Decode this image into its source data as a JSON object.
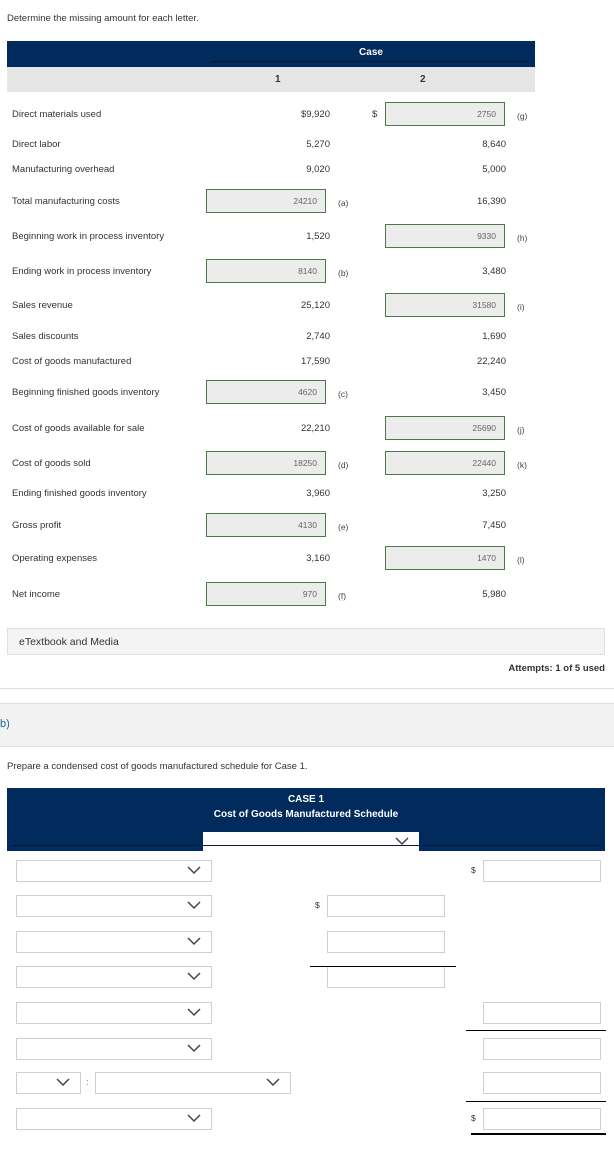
{
  "part_a": {
    "instruction": "Determine the missing amount for each letter.",
    "header": {
      "group_label": "Case",
      "columns": [
        "1",
        "2"
      ]
    },
    "rows": [
      {
        "label": "Direct materials used",
        "case1": "$9,920",
        "case2": {
          "input": "2750",
          "letter": "(g)",
          "prefix": "$"
        }
      },
      {
        "label": "Direct labor",
        "case1": "5,270",
        "case2": "8,640"
      },
      {
        "label": "Manufacturing overhead",
        "case1": "9,020",
        "case2": "5,000"
      },
      {
        "label": "Total manufacturing costs",
        "case1": {
          "input": "24210",
          "letter": "(a)"
        },
        "case2": "16,390"
      },
      {
        "label": "Beginning work in process inventory",
        "case1": "1,520",
        "case2": {
          "input": "9330",
          "letter": "(h)"
        }
      },
      {
        "label": "Ending work in process inventory",
        "case1": {
          "input": "8140",
          "letter": "(b)"
        },
        "case2": "3,480"
      },
      {
        "label": "Sales revenue",
        "case1": "25,120",
        "case2": {
          "input": "31580",
          "letter": "(i)"
        }
      },
      {
        "label": "Sales discounts",
        "case1": "2,740",
        "case2": "1,690"
      },
      {
        "label": "Cost of goods manufactured",
        "case1": "17,590",
        "case2": "22,240"
      },
      {
        "label": "Beginning finished goods inventory",
        "case1": {
          "input": "4620",
          "letter": "(c)"
        },
        "case2": "3,450"
      },
      {
        "label": "Cost of goods available for sale",
        "case1": "22,210",
        "case2": {
          "input": "25690",
          "letter": "(j)"
        }
      },
      {
        "label": "Cost of goods sold",
        "case1": {
          "input": "18250",
          "letter": "(d)"
        },
        "case2": {
          "input": "22440",
          "letter": "(k)"
        }
      },
      {
        "label": "Ending finished goods inventory",
        "case1": "3,960",
        "case2": "3,250"
      },
      {
        "label": "Gross profit",
        "case1": {
          "input": "4130",
          "letter": "(e)"
        },
        "case2": "7,450"
      },
      {
        "label": "Operating expenses",
        "case1": "3,160",
        "case2": {
          "input": "1470",
          "letter": "(l)"
        }
      },
      {
        "label": "Net income",
        "case1": {
          "input": "970",
          "letter": "(f)"
        },
        "case2": "5,980"
      }
    ],
    "etextbook_label": "eTextbook and Media",
    "attempts": "Attempts: 1 of 5 used"
  },
  "part_b": {
    "label": "b)",
    "instruction": "Prepare a condensed cost of goods manufactured schedule for Case 1.",
    "header_title": "CASE 1",
    "header_subtitle": "Cost of Goods Manufactured Schedule",
    "period_select": "",
    "currency_symbol": "$",
    "colon": ":",
    "rows": [
      {
        "select": "",
        "col2": null,
        "col3": ""
      },
      {
        "select": "",
        "col2": "",
        "col3": null
      },
      {
        "select": "",
        "col2": "",
        "col3": null
      },
      {
        "select": "",
        "col2": "",
        "col3": null
      },
      {
        "select": "",
        "col2": null,
        "col3": ""
      },
      {
        "select": "",
        "col2": null,
        "col3": ""
      },
      {
        "select_small": "",
        "select": "",
        "col2": null,
        "col3": ""
      },
      {
        "select": "",
        "col2": null,
        "col3": ""
      }
    ]
  }
}
